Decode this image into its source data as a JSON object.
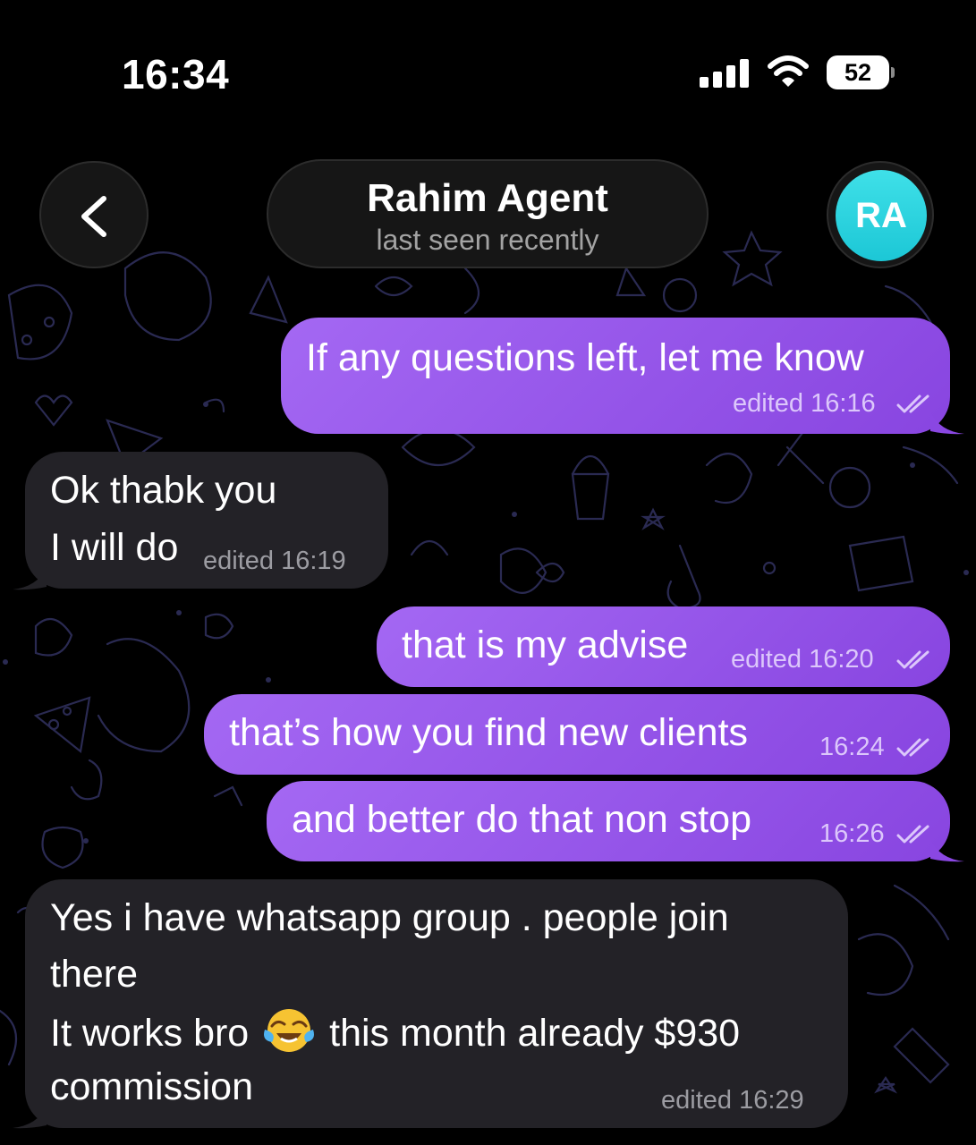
{
  "status_bar": {
    "time": "16:34",
    "battery_level": "52"
  },
  "header": {
    "contact_name": "Rahim Agent",
    "contact_status": "last seen recently",
    "avatar_initials": "RA",
    "avatar_color": "#2fd6e2"
  },
  "colors": {
    "outgoing_bubble": "#9657ea",
    "incoming_bubble": "#232227",
    "background": "#000000"
  },
  "messages": [
    {
      "direction": "out",
      "lines": [
        "If any questions left, let me know"
      ],
      "meta": "edited 16:16",
      "read": true
    },
    {
      "direction": "in",
      "lines": [
        "Ok thabk you",
        "I will do"
      ],
      "meta": "edited 16:19"
    },
    {
      "direction": "out",
      "lines": [
        "that is my advise"
      ],
      "meta": "edited 16:20",
      "read": true
    },
    {
      "direction": "out",
      "lines": [
        "that’s how you find new clients"
      ],
      "meta": "16:24",
      "read": true
    },
    {
      "direction": "out",
      "lines": [
        "and better do that non stop"
      ],
      "meta": "16:26",
      "read": true
    },
    {
      "direction": "in",
      "lines": [
        "Yes i have whatsapp group . people join",
        "there",
        "It works bro",
        "this month already $930",
        "commission"
      ],
      "emoji": "face-with-tears-of-joy",
      "meta": "edited 16:29"
    }
  ]
}
